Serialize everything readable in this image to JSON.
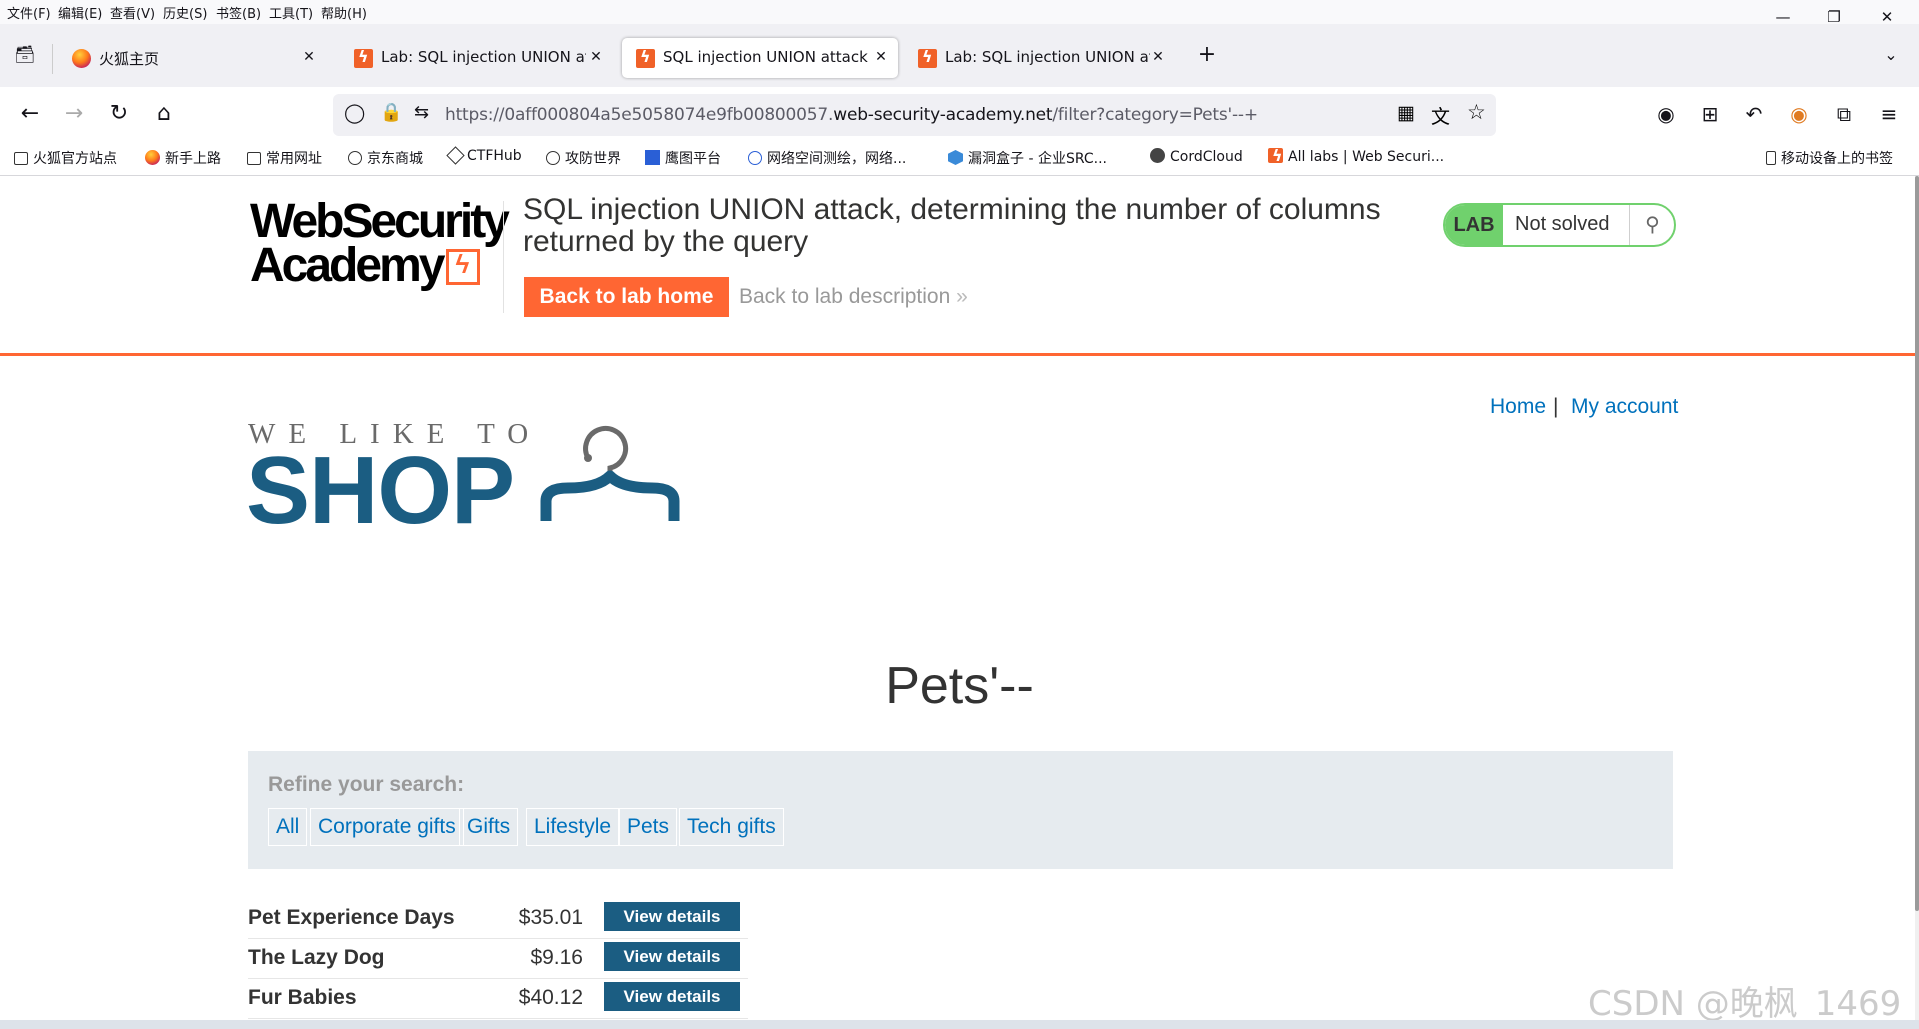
{
  "browser": {
    "menu": [
      "文件(F)",
      "编辑(E)",
      "查看(V)",
      "历史(S)",
      "书签(B)",
      "工具(T)",
      "帮助(H)"
    ],
    "tabs": [
      {
        "title": "火狐主页",
        "active": false
      },
      {
        "title": "Lab: SQL injection UNION att",
        "active": false
      },
      {
        "title": "SQL injection UNION attack,",
        "active": true
      },
      {
        "title": "Lab: SQL injection UNION att",
        "active": false
      }
    ],
    "url_prefix": "https://0aff000804a5e5058074e9fb00800057.",
    "url_host": "web-security-academy.net",
    "url_path": "/filter?category=Pets'--+",
    "bookmarks": [
      "火狐官方站点",
      "新手上路",
      "常用网址",
      "京东商城",
      "CTFHub",
      "攻防世界",
      "鹰图平台",
      "网络空间测绘，网络...",
      "漏洞盒子 - 企业SRC...",
      "CordCloud",
      "All labs | Web Securi..."
    ],
    "mobile_bookmarks": "移动设备上的书签"
  },
  "header": {
    "logo_line1": "WebSecurity",
    "logo_line2": "Academy",
    "lab_title": "SQL injection UNION attack, determining the number of columns returned by the query",
    "back_home": "Back to lab home",
    "back_desc": "Back to lab description",
    "back_desc_chevron": "»",
    "lab_label": "LAB",
    "lab_status": "Not solved"
  },
  "nav": {
    "home": "Home",
    "separator": "|",
    "account": "My account"
  },
  "shop": {
    "tagline": "WE LIKE TO",
    "word": "SHOP"
  },
  "category_heading": "Pets'--",
  "filter": {
    "label": "Refine your search:",
    "options": [
      "All",
      "Corporate gifts",
      "Gifts",
      "Lifestyle",
      "Pets",
      "Tech gifts"
    ]
  },
  "products": [
    {
      "name": "Pet Experience Days",
      "price": "$35.01",
      "button": "View details"
    },
    {
      "name": "The Lazy Dog",
      "price": "$9.16",
      "button": "View details"
    },
    {
      "name": "Fur Babies",
      "price": "$40.12",
      "button": "View details"
    }
  ],
  "watermark": "CSDN @晚枫_1469",
  "colors": {
    "accent": "#ff6633",
    "link": "#0071bc",
    "primary": "#1b5d82",
    "lab_green": "#70d16d"
  }
}
